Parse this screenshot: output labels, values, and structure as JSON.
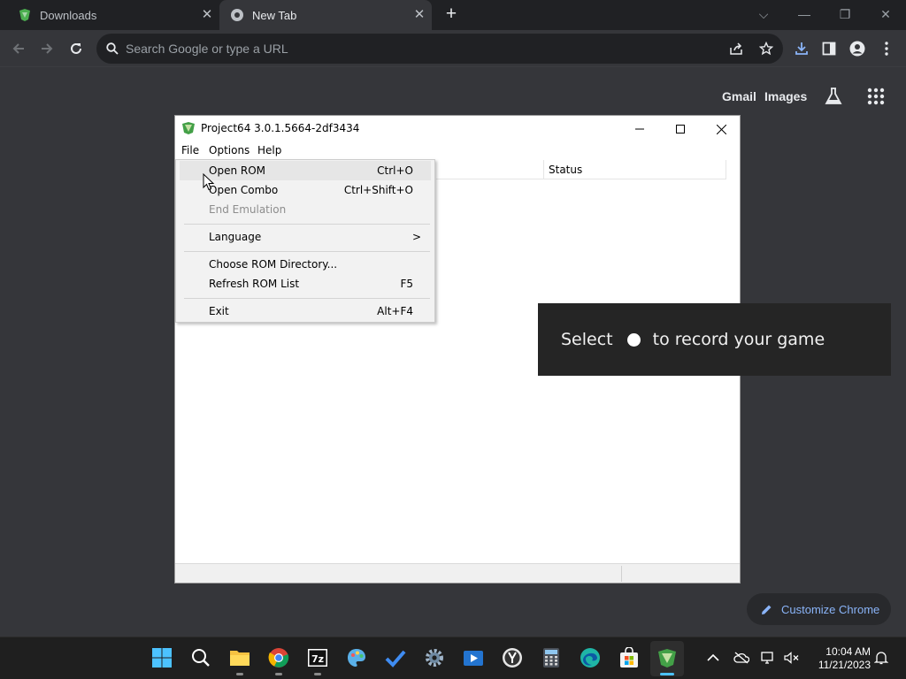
{
  "browser": {
    "tabs": [
      {
        "label": "Downloads",
        "active": false
      },
      {
        "label": "New Tab",
        "active": true
      }
    ],
    "omnibox": {
      "placeholder": "Search Google or type a URL"
    },
    "ntp": {
      "links": [
        "Gmail",
        "Images"
      ],
      "customize_label": "Customize Chrome"
    }
  },
  "project64": {
    "title": "Project64 3.0.1.5664-2df3434",
    "menubar": [
      "File",
      "Options",
      "Help"
    ],
    "list_header": {
      "status": "Status"
    },
    "file_menu": [
      {
        "label": "Open ROM",
        "shortcut": "Ctrl+O",
        "highlighted": true
      },
      {
        "label": "Open Combo",
        "shortcut": "Ctrl+Shift+O"
      },
      {
        "label": "End Emulation",
        "shortcut": "",
        "disabled": true
      },
      {
        "label": "Language",
        "shortcut": ">"
      },
      {
        "label": "Choose ROM Directory...",
        "shortcut": ""
      },
      {
        "label": "Refresh ROM List",
        "shortcut": "F5"
      },
      {
        "label": "Exit",
        "shortcut": "Alt+F4"
      }
    ]
  },
  "gamebar_toast": {
    "before": "Select",
    "after": "to record your game"
  },
  "taskbar": {
    "apps": [
      "start-icon",
      "search-icon",
      "file-explorer-icon",
      "chrome-icon",
      "7zip-icon",
      "paint-icon",
      "todo-icon",
      "settings-icon",
      "media-player-icon",
      "yandex-icon",
      "calculator-icon",
      "edge-icon",
      "store-icon",
      "project64-icon"
    ],
    "clock": {
      "time": "10:04 AM",
      "date": "11/21/2023"
    }
  },
  "colors": {
    "chrome_dark": "#202124",
    "toolbar": "#35363a",
    "link_blue": "#8ab4f8",
    "taskbar": "#1f1f1f"
  }
}
